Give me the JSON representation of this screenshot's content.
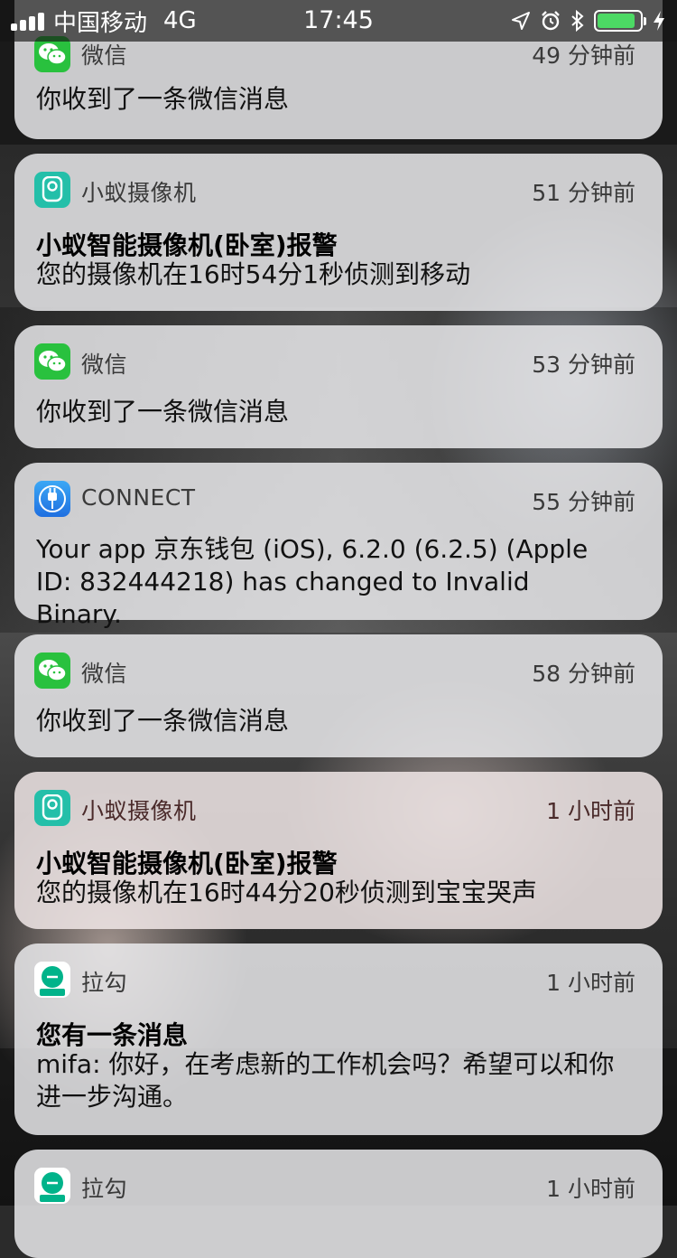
{
  "status_bar": {
    "carrier": "中国移动",
    "network": "4G",
    "time": "17:45",
    "battery_level": 0.9,
    "battery_color": "#4cd964"
  },
  "notifications": [
    {
      "app": "微信",
      "time": "49 分钟前",
      "title": "",
      "body": "你收到了一条微信消息",
      "icon": "wechat-icon"
    },
    {
      "app": "小蚁摄像机",
      "time": "51 分钟前",
      "title": "小蚁智能摄像机(卧室)报警",
      "body": "您的摄像机在16时54分1秒侦测到移动",
      "icon": "camera-icon"
    },
    {
      "app": "微信",
      "time": "53 分钟前",
      "title": "",
      "body": "你收到了一条微信消息",
      "icon": "wechat-icon"
    },
    {
      "app": "CONNECT",
      "time": "55 分钟前",
      "title": "",
      "body": "Your app 京东钱包 (iOS), 6.2.0 (6.2.5) (Apple ID: 832444218) has changed to Invalid Binary.",
      "icon": "connect-icon"
    },
    {
      "app": "微信",
      "time": "58 分钟前",
      "title": "",
      "body": "你收到了一条微信消息",
      "icon": "wechat-icon"
    },
    {
      "app": "小蚁摄像机",
      "time": "1 小时前",
      "title": "小蚁智能摄像机(卧室)报警",
      "body": "您的摄像机在16时44分20秒侦测到宝宝哭声",
      "icon": "camera-icon"
    },
    {
      "app": "拉勾",
      "time": "1 小时前",
      "title": "您有一条消息",
      "body": "mifa: 你好，在考虑新的工作机会吗？希望可以和你进一步沟通。",
      "icon": "lagou-icon"
    },
    {
      "app": "拉勾",
      "time": "1 小时前",
      "title": "",
      "body": "",
      "icon": "lagou-icon"
    }
  ]
}
